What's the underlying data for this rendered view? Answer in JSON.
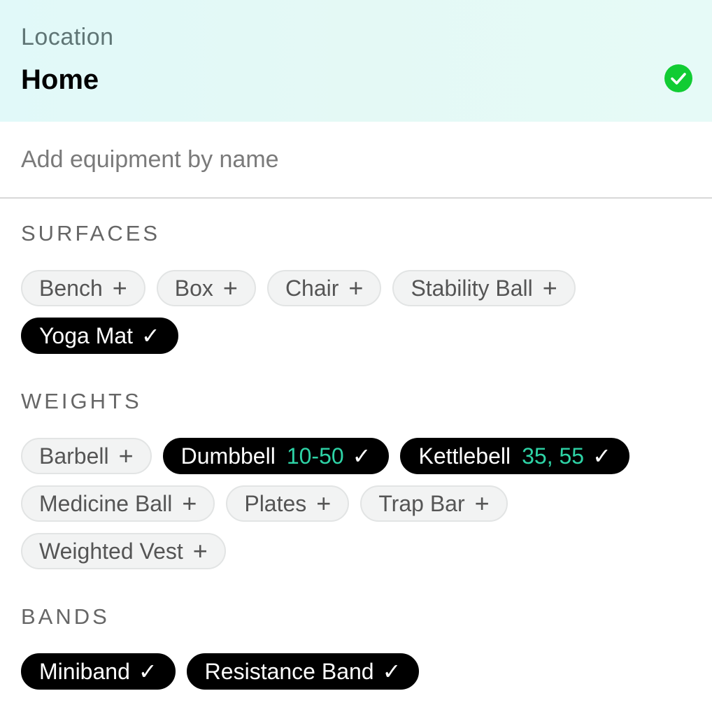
{
  "location": {
    "label": "Location",
    "value": "Home",
    "status_icon": "check-circle-icon",
    "status_color": "#11cc33"
  },
  "search": {
    "placeholder": "Add equipment by name",
    "value": ""
  },
  "sections": [
    {
      "title": "SURFACES",
      "items": [
        {
          "label": "Bench",
          "selected": false,
          "qty": ""
        },
        {
          "label": "Box",
          "selected": false,
          "qty": ""
        },
        {
          "label": "Chair",
          "selected": false,
          "qty": ""
        },
        {
          "label": "Stability Ball",
          "selected": false,
          "qty": ""
        },
        {
          "label": "Yoga Mat",
          "selected": true,
          "qty": ""
        }
      ]
    },
    {
      "title": "WEIGHTS",
      "items": [
        {
          "label": "Barbell",
          "selected": false,
          "qty": ""
        },
        {
          "label": "Dumbbell",
          "selected": true,
          "qty": "10-50"
        },
        {
          "label": "Kettlebell",
          "selected": true,
          "qty": "35, 55"
        },
        {
          "label": "Medicine Ball",
          "selected": false,
          "qty": ""
        },
        {
          "label": "Plates",
          "selected": false,
          "qty": ""
        },
        {
          "label": "Trap Bar",
          "selected": false,
          "qty": ""
        },
        {
          "label": "Weighted Vest",
          "selected": false,
          "qty": ""
        }
      ]
    },
    {
      "title": "BANDS",
      "items": [
        {
          "label": "Miniband",
          "selected": true,
          "qty": ""
        },
        {
          "label": "Resistance Band",
          "selected": true,
          "qty": ""
        }
      ]
    }
  ],
  "glyphs": {
    "add": "+",
    "selected": "✓"
  },
  "colors": {
    "selected_chip": "#000000",
    "qty_text": "#2ed3a6",
    "unselected_chip": "#f2f3f3"
  }
}
